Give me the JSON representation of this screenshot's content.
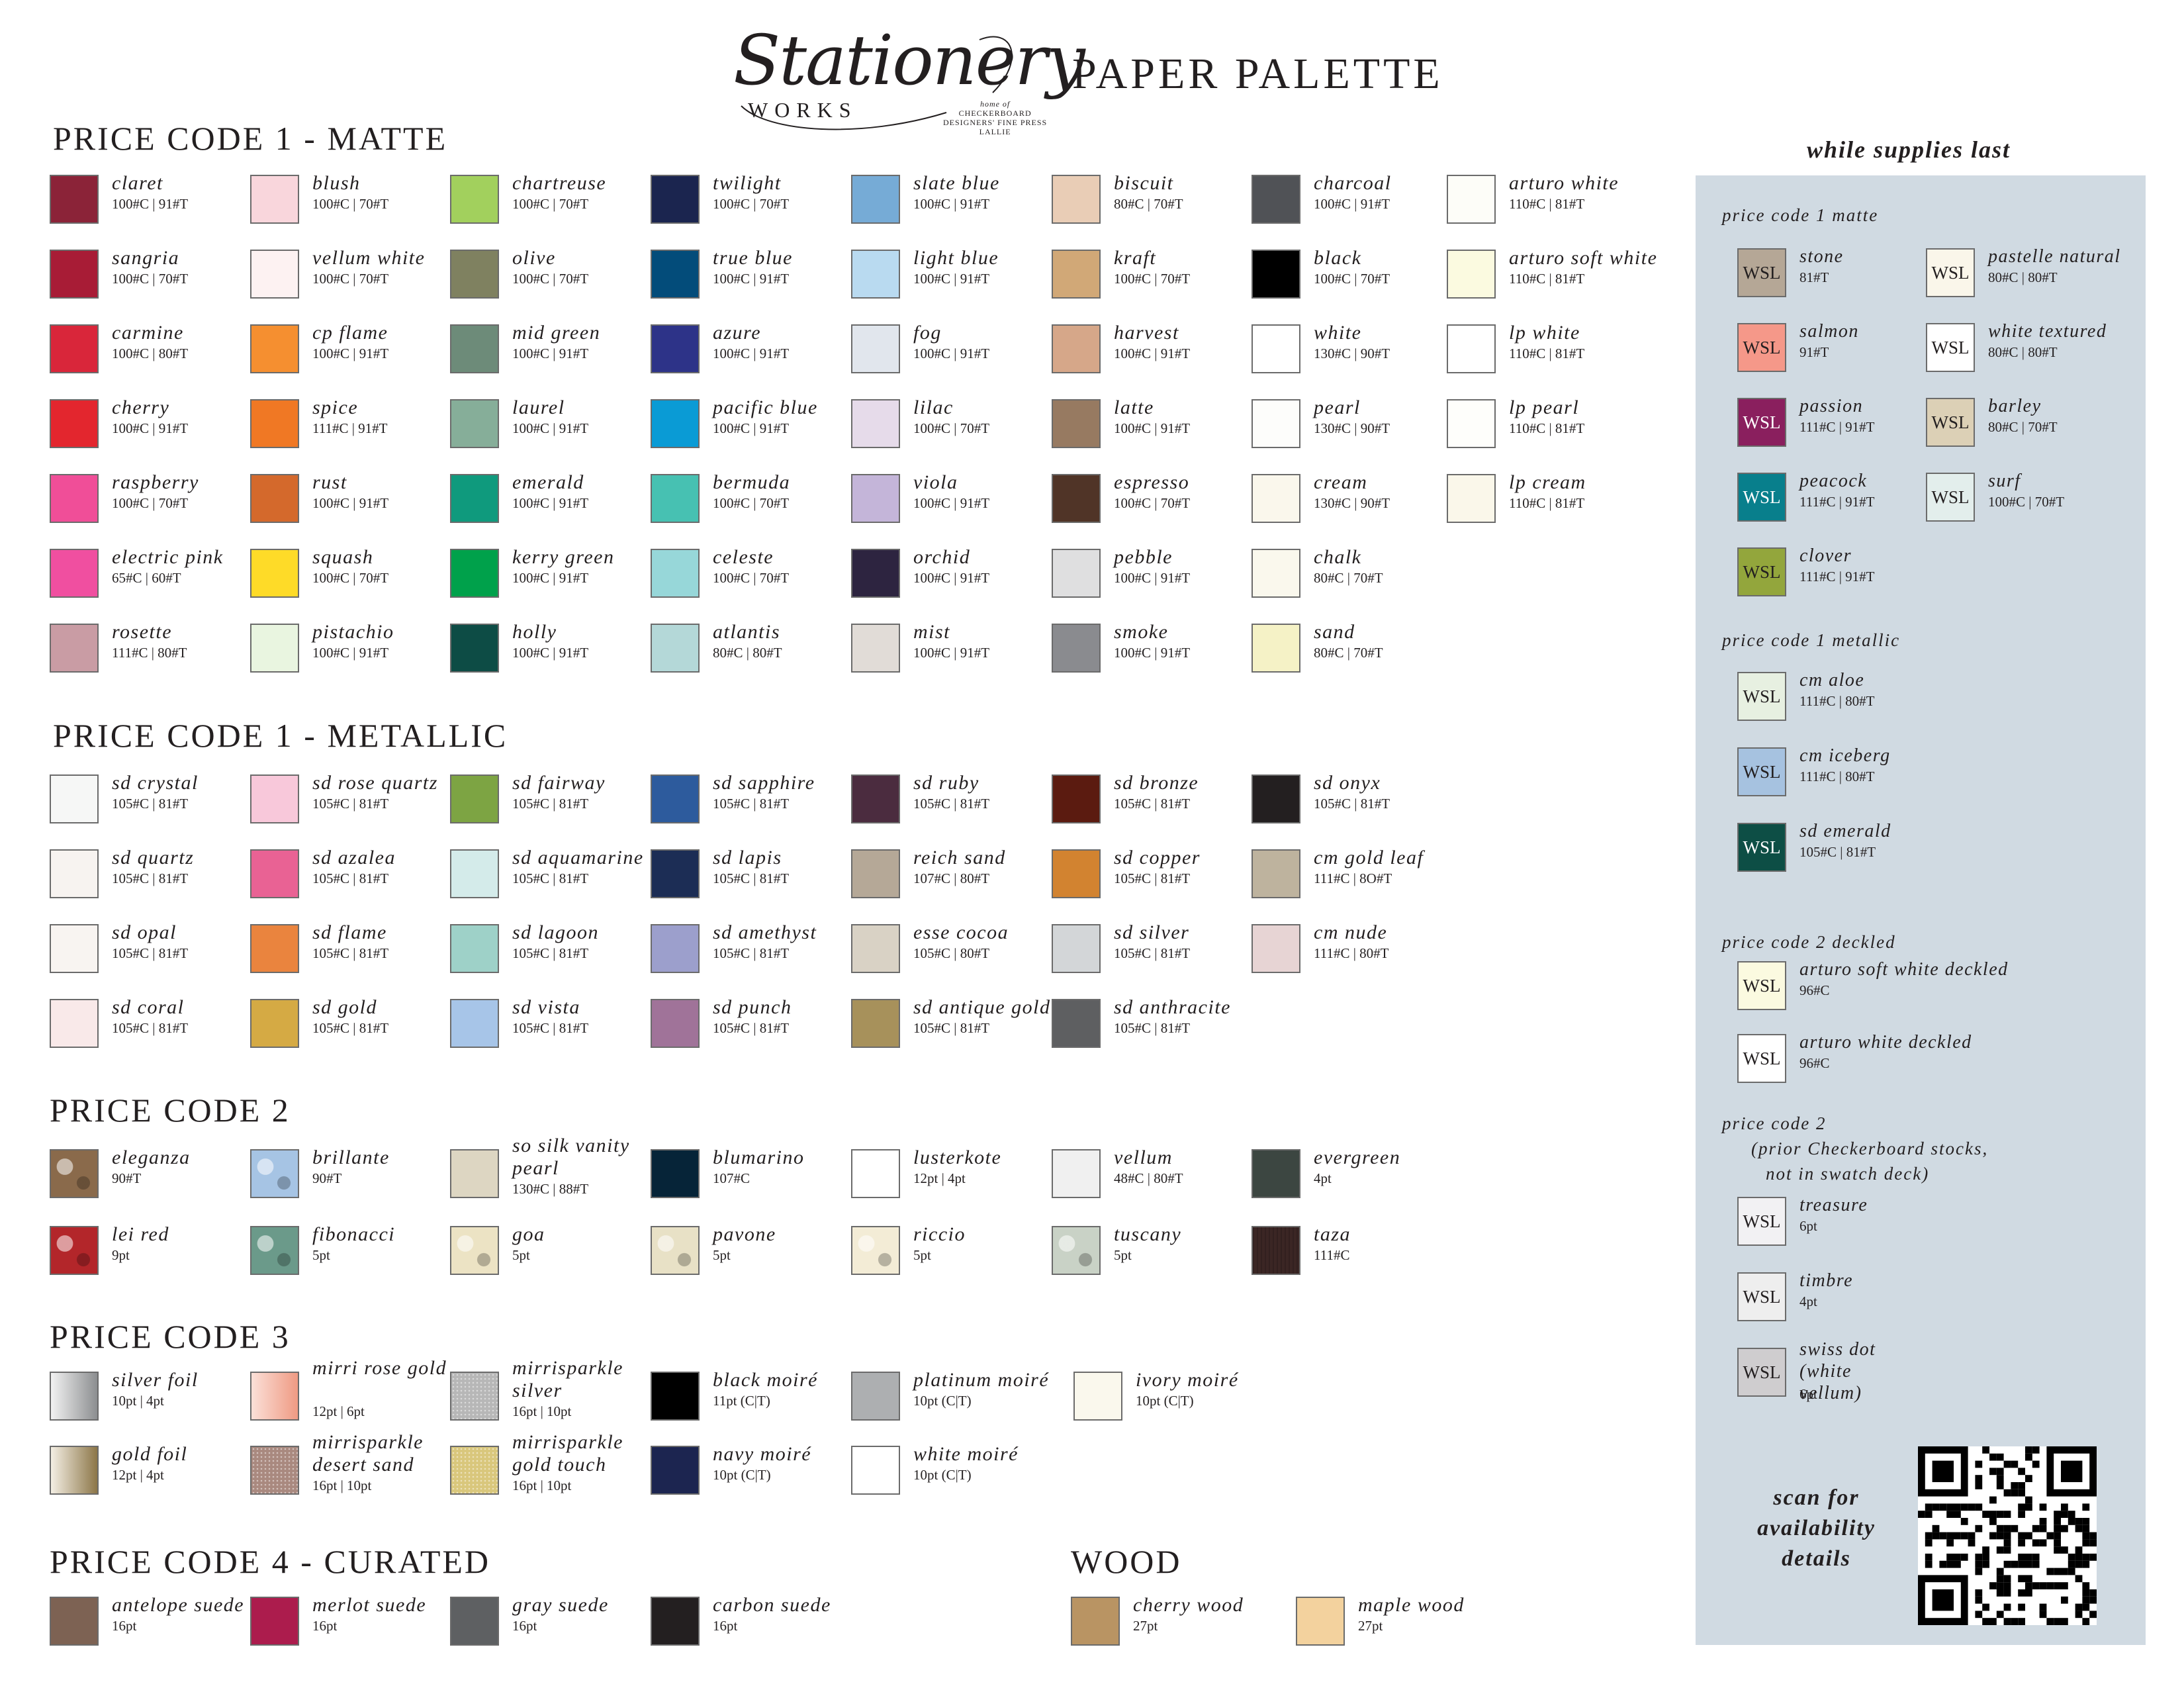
{
  "header": {
    "logo_script": "Stationery",
    "logo_works": "WORKS",
    "logo_small": [
      "home of",
      "CHECKERBOARD",
      "DESIGNERS' FINE PRESS",
      "LALLIE"
    ],
    "title": "PAPER PALETTE"
  },
  "sections": {
    "matte": "PRICE CODE 1 - MATTE",
    "metallic": "PRICE CODE 1 - METALLIC",
    "code2": "PRICE CODE 2",
    "code3": "PRICE CODE 3",
    "code4": "PRICE CODE 4 - CURATED",
    "wood": "WOOD"
  },
  "matte": [
    {
      "name": "claret",
      "weight": "100#C | 91#T",
      "color": "#8b2338"
    },
    {
      "name": "sangria",
      "weight": "100#C | 70#T",
      "color": "#a81c36"
    },
    {
      "name": "carmine",
      "weight": "100#C | 80#T",
      "color": "#d9263a"
    },
    {
      "name": "cherry",
      "weight": "100#C | 91#T",
      "color": "#e3262e"
    },
    {
      "name": "raspberry",
      "weight": "100#C | 70#T",
      "color": "#f04e98"
    },
    {
      "name": "electric pink",
      "weight": "65#C | 60#T",
      "color": "#f04fa0"
    },
    {
      "name": "rosette",
      "weight": "111#C | 80#T",
      "color": "#c99ca4"
    },
    {
      "name": "blush",
      "weight": "100#C | 70#T",
      "color": "#f9d6dc"
    },
    {
      "name": "vellum white",
      "weight": "100#C | 70#T",
      "color": "#fdf2f2"
    },
    {
      "name": "cp flame",
      "weight": "100#C | 91#T",
      "color": "#f58f30"
    },
    {
      "name": "spice",
      "weight": "111#C | 91#T",
      "color": "#f07824"
    },
    {
      "name": "rust",
      "weight": "100#C | 91#T",
      "color": "#d4692c"
    },
    {
      "name": "squash",
      "weight": "100#C | 70#T",
      "color": "#fedb28"
    },
    {
      "name": "pistachio",
      "weight": "100#C | 91#T",
      "color": "#e9f5e0"
    },
    {
      "name": "chartreuse",
      "weight": "100#C | 70#T",
      "color": "#a2d05d"
    },
    {
      "name": "olive",
      "weight": "100#C | 70#T",
      "color": "#7f8160"
    },
    {
      "name": "mid green",
      "weight": "100#C | 91#T",
      "color": "#6d8b79"
    },
    {
      "name": "laurel",
      "weight": "100#C | 91#T",
      "color": "#86ae99"
    },
    {
      "name": "emerald",
      "weight": "100#C | 91#T",
      "color": "#0f9a7d"
    },
    {
      "name": "kerry green",
      "weight": "100#C | 91#T",
      "color": "#00a14b"
    },
    {
      "name": "holly",
      "weight": "100#C | 91#T",
      "color": "#0d4c45"
    },
    {
      "name": "twilight",
      "weight": "100#C | 70#T",
      "color": "#1b254f"
    },
    {
      "name": "true blue",
      "weight": "100#C | 91#T",
      "color": "#034c7a"
    },
    {
      "name": "azure",
      "weight": "100#C | 91#T",
      "color": "#2d3388"
    },
    {
      "name": "pacific blue",
      "weight": "100#C | 91#T",
      "color": "#0a9bd5"
    },
    {
      "name": "bermuda",
      "weight": "100#C | 70#T",
      "color": "#47c1b2"
    },
    {
      "name": "celeste",
      "weight": "100#C | 70#T",
      "color": "#97d7d9"
    },
    {
      "name": "atlantis",
      "weight": "80#C | 80#T",
      "color": "#b4d8d8"
    },
    {
      "name": "slate blue",
      "weight": "100#C | 91#T",
      "color": "#76abd6"
    },
    {
      "name": "light blue",
      "weight": "100#C | 91#T",
      "color": "#b9daf0"
    },
    {
      "name": "fog",
      "weight": "100#C | 91#T",
      "color": "#e1e6ed"
    },
    {
      "name": "lilac",
      "weight": "100#C | 70#T",
      "color": "#e6dbea"
    },
    {
      "name": "viola",
      "weight": "100#C | 91#T",
      "color": "#c4b5d9"
    },
    {
      "name": "orchid",
      "weight": "100#C | 91#T",
      "color": "#2d2440"
    },
    {
      "name": "mist",
      "weight": "100#C | 91#T",
      "color": "#e1dcd7"
    },
    {
      "name": "biscuit",
      "weight": "80#C | 70#T",
      "color": "#e9cdb6"
    },
    {
      "name": "kraft",
      "weight": "100#C | 70#T",
      "color": "#d1a877"
    },
    {
      "name": "harvest",
      "weight": "100#C | 91#T",
      "color": "#d6a789"
    },
    {
      "name": "latte",
      "weight": "100#C | 91#T",
      "color": "#977a61"
    },
    {
      "name": "espresso",
      "weight": "100#C | 70#T",
      "color": "#503427"
    },
    {
      "name": "pebble",
      "weight": "100#C | 91#T",
      "color": "#dfdfe0"
    },
    {
      "name": "smoke",
      "weight": "100#C | 91#T",
      "color": "#8a8b8f"
    },
    {
      "name": "charcoal",
      "weight": "100#C | 91#T",
      "color": "#505256"
    },
    {
      "name": "black",
      "weight": "100#C | 70#T",
      "color": "#000000"
    },
    {
      "name": "white",
      "weight": "130#C | 90#T",
      "color": "#ffffff"
    },
    {
      "name": "pearl",
      "weight": "130#C | 90#T",
      "color": "#fdfdfb"
    },
    {
      "name": "cream",
      "weight": "130#C | 90#T",
      "color": "#faf7ec"
    },
    {
      "name": "chalk",
      "weight": "80#C | 70#T",
      "color": "#faf8ed"
    },
    {
      "name": "sand",
      "weight": "80#C | 70#T",
      "color": "#f5f2c6"
    },
    {
      "name": "arturo white",
      "weight": "110#C | 81#T",
      "color": "#fdfdf8"
    },
    {
      "name": "arturo soft white",
      "weight": "110#C | 81#T",
      "color": "#fbfae0"
    },
    {
      "name": "lp white",
      "weight": "110#C | 81#T",
      "color": "#ffffff"
    },
    {
      "name": "lp pearl",
      "weight": "110#C | 81#T",
      "color": "#fefefb"
    },
    {
      "name": "lp cream",
      "weight": "110#C | 81#T",
      "color": "#faf7ea"
    }
  ],
  "metallic": [
    {
      "name": "sd crystal",
      "weight": "105#C | 81#T",
      "color": "#f6f7f6"
    },
    {
      "name": "sd quartz",
      "weight": "105#C | 81#T",
      "color": "#f7f3f0"
    },
    {
      "name": "sd opal",
      "weight": "105#C | 81#T",
      "color": "#f8f4f1"
    },
    {
      "name": "sd coral",
      "weight": "105#C | 81#T",
      "color": "#f9e9e9"
    },
    {
      "name": "sd rose quartz",
      "weight": "105#C | 81#T",
      "color": "#f8c8da"
    },
    {
      "name": "sd azalea",
      "weight": "105#C | 81#T",
      "color": "#e96294"
    },
    {
      "name": "sd flame",
      "weight": "105#C | 81#T",
      "color": "#ea843e"
    },
    {
      "name": "sd gold",
      "weight": "105#C | 81#T",
      "color": "#d5aa44"
    },
    {
      "name": "sd fairway",
      "weight": "105#C | 81#T",
      "color": "#7da443"
    },
    {
      "name": "sd aquamarine",
      "weight": "105#C | 81#T",
      "color": "#d4ebea"
    },
    {
      "name": "sd lagoon",
      "weight": "105#C | 81#T",
      "color": "#9ed1c8"
    },
    {
      "name": "sd vista",
      "weight": "105#C | 81#T",
      "color": "#a7c5e8"
    },
    {
      "name": "sd sapphire",
      "weight": "105#C | 81#T",
      "color": "#2d5b9d"
    },
    {
      "name": "sd lapis",
      "weight": "105#C | 81#T",
      "color": "#1c2d55"
    },
    {
      "name": "sd amethyst",
      "weight": "105#C | 81#T",
      "color": "#9c9fcc"
    },
    {
      "name": "sd punch",
      "weight": "105#C | 81#T",
      "color": "#a07399"
    },
    {
      "name": "sd ruby",
      "weight": "105#C | 81#T",
      "color": "#4b2c3f"
    },
    {
      "name": "reich sand",
      "weight": "107#C | 80#T",
      "color": "#b5a897"
    },
    {
      "name": "esse cocoa",
      "weight": "105#C | 80#T",
      "color": "#d9d2c5"
    },
    {
      "name": "sd antique gold",
      "weight": "105#C | 81#T",
      "color": "#a7915b"
    },
    {
      "name": "sd bronze",
      "weight": "105#C | 81#T",
      "color": "#5b1b10"
    },
    {
      "name": "sd copper",
      "weight": "105#C | 81#T",
      "color": "#d28330"
    },
    {
      "name": "sd silver",
      "weight": "105#C | 81#T",
      "color": "#d3d6d8"
    },
    {
      "name": "sd anthracite",
      "weight": "105#C | 81#T",
      "color": "#5e5f61"
    },
    {
      "name": "sd onyx",
      "weight": "105#C | 81#T",
      "color": "#231f20"
    },
    {
      "name": "cm gold leaf",
      "weight": "111#C | 8O#T",
      "color": "#beb39e"
    },
    {
      "name": "cm nude",
      "weight": "111#C | 80#T",
      "color": "#e7d4d4"
    }
  ],
  "code2": [
    {
      "name": "eleganza",
      "weight": "90#T",
      "color": "#8a6a4b"
    },
    {
      "name": "lei red",
      "weight": "9pt",
      "color": "#b3262a"
    },
    {
      "name": "brillante",
      "weight": "90#T",
      "color": "#a6c4e4"
    },
    {
      "name": "fibonacci",
      "weight": "5pt",
      "color": "#6b9a8a"
    },
    {
      "name": "so silk vanity pearl",
      "weight": "130#C | 88#T",
      "color": "#ddd6c2"
    },
    {
      "name": "goa",
      "weight": "5pt",
      "color": "#ece3c4"
    },
    {
      "name": "blumarino",
      "weight": "107#C",
      "color": "#062438"
    },
    {
      "name": "pavone",
      "weight": "5pt",
      "color": "#e8e1c6"
    },
    {
      "name": "lusterkote",
      "weight": "12pt | 4pt",
      "color": "#ffffff"
    },
    {
      "name": "riccio",
      "weight": "5pt",
      "color": "#f3ecd6"
    },
    {
      "name": "vellum",
      "weight": "48#C | 80#T",
      "color": "#f0f0f0"
    },
    {
      "name": "tuscany",
      "weight": "5pt",
      "color": "#c9d2c6"
    },
    {
      "name": "evergreen",
      "weight": "4pt",
      "color": "#3c4641"
    },
    {
      "name": "taza",
      "weight": "111#C",
      "color": "#3b2624"
    }
  ],
  "code3": [
    {
      "name": "silver foil",
      "weight": "10pt | 4pt",
      "color": "#c2c4c6"
    },
    {
      "name": "gold foil",
      "weight": "12pt | 4pt",
      "color": "#b9a37a"
    },
    {
      "name": "mirri rose gold",
      "weight": "12pt | 6pt",
      "color": "#f3b8a8"
    },
    {
      "name": "mirrisparkle desert sand",
      "weight": "16pt | 10pt",
      "color": "#a9897f"
    },
    {
      "name": "mirrisparkle silver",
      "weight": "16pt | 10pt",
      "color": "#b7b7b7"
    },
    {
      "name": "mirrisparkle gold touch",
      "weight": "16pt | 10pt",
      "color": "#d9c77c"
    },
    {
      "name": "black moiré",
      "weight": "11pt (C|T)",
      "color": "#000000"
    },
    {
      "name": "navy moiré",
      "weight": "10pt  (C|T)",
      "color": "#1c2550"
    },
    {
      "name": "platinum moiré",
      "weight": "10pt  (C|T)",
      "color": "#adafb1"
    },
    {
      "name": "white  moiré",
      "weight": "10pt  (C|T)",
      "color": "#ffffff"
    },
    {
      "name": "ivory moiré",
      "weight": "10pt  (C|T)",
      "color": "#faf8ed"
    }
  ],
  "code4": [
    {
      "name": "antelope suede",
      "weight": "16pt",
      "color": "#7d6253"
    },
    {
      "name": "merlot suede",
      "weight": "16pt",
      "color": "#ac1c4d"
    },
    {
      "name": "gray suede",
      "weight": "16pt",
      "color": "#5e6062"
    },
    {
      "name": "carbon suede",
      "weight": "16pt",
      "color": "#231f20"
    }
  ],
  "wood": [
    {
      "name": "cherry wood",
      "weight": "27pt",
      "color": "#b99463"
    },
    {
      "name": "maple wood",
      "weight": "27pt",
      "color": "#f3d29e"
    }
  ],
  "sidebar": {
    "title": "while supplies last",
    "label": "WSL",
    "heading_matte": "price code 1 matte",
    "heading_metallic": "price code 1 metallic",
    "heading_code2_deckled": "price code 2 deckled",
    "heading_code2_prior": [
      "price code 2",
      "(prior Checkerboard stocks,",
      "not in swatch deck)"
    ],
    "matte": [
      {
        "name": "stone",
        "weight": "81#T",
        "color": "#b5a796",
        "dark": false
      },
      {
        "name": "salmon",
        "weight": "91#T",
        "color": "#f59889",
        "dark": false
      },
      {
        "name": "passion",
        "weight": "111#C | 91#T",
        "color": "#8a1f5e",
        "dark": true
      },
      {
        "name": "peacock",
        "weight": "111#C | 91#T",
        "color": "#087f8c",
        "dark": true
      },
      {
        "name": "clover",
        "weight": "111#C | 91#T",
        "color": "#93a63c",
        "dark": false
      },
      {
        "name": "pastelle natural",
        "weight": "80#C | 80#T",
        "color": "#faf6ea",
        "dark": false
      },
      {
        "name": "white textured",
        "weight": "80#C | 80#T",
        "color": "#ffffff",
        "dark": false
      },
      {
        "name": "barley",
        "weight": "80#C | 70#T",
        "color": "#dcd0b6",
        "dark": false
      },
      {
        "name": "surf",
        "weight": "100#C | 70#T",
        "color": "#e3eeec",
        "dark": false
      }
    ],
    "metallic": [
      {
        "name": "cm aloe",
        "weight": "111#C | 80#T",
        "color": "#e7f0e1",
        "dark": false
      },
      {
        "name": "cm iceberg",
        "weight": "111#C | 80#T",
        "color": "#a6c2e0",
        "dark": false
      },
      {
        "name": "sd emerald",
        "weight": "105#C | 81#T",
        "color": "#0d4e45",
        "dark": true
      }
    ],
    "deckled": [
      {
        "name": "arturo soft white deckled",
        "weight": "96#C",
        "color": "#fbfae0",
        "dark": false
      },
      {
        "name": "arturo white deckled",
        "weight": "96#C",
        "color": "#ffffff",
        "dark": false
      }
    ],
    "prior": [
      {
        "name": "treasure",
        "weight": "6pt",
        "color": "#f2f1f3",
        "dark": false
      },
      {
        "name": "timbre",
        "weight": "4pt",
        "color": "#eeeeee",
        "dark": false
      },
      {
        "name": "swiss dot (white vellum)",
        "weight": "6pt",
        "color": "#cfcdcf",
        "dark": false
      }
    ],
    "scan_text": [
      "scan for",
      "availability",
      "details"
    ]
  }
}
